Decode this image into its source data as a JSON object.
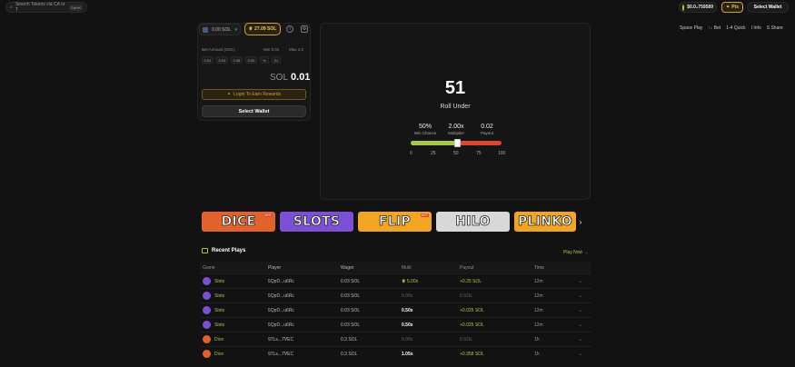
{
  "search": {
    "placeholder": "Search Tokens via CA or T",
    "kbd": "Ctrl+K"
  },
  "header": {
    "balance": "$0.0₄759589",
    "points": "Pts",
    "wallet_button": "Select Wallet"
  },
  "bet_panel": {
    "wallet_balance": "0.00 SOL",
    "rewards_balance": "27.09 SOL",
    "bet_amount_label": "Bet Amount (SOL)",
    "min_label": "Min 0.01",
    "max_label": "Max 1.0",
    "quick_amounts": [
      "0.01",
      "0.03",
      "0.08",
      "0.20",
      "½",
      "2×"
    ],
    "currency": "SOL",
    "amount": "0.01",
    "login_button": "Login To Earn Rewards",
    "select_wallet_button": "Select Wallet"
  },
  "game": {
    "roll_number": "51",
    "roll_label": "Roll Under",
    "stats": [
      {
        "value": "50%",
        "label": "Win Chance"
      },
      {
        "value": "2.00x",
        "label": "Multiplier"
      },
      {
        "value": "0.02",
        "label": "Payout"
      }
    ],
    "slider_value": 51,
    "ticks": [
      "0",
      "25",
      "50",
      "75",
      "100"
    ]
  },
  "hotkeys": [
    "Space Play",
    "↑↓ Bet",
    "1-4 Quick",
    "I Info",
    "S Share"
  ],
  "tiles": [
    {
      "label": "DICE",
      "color": "#e2622c",
      "hot": "HOT"
    },
    {
      "label": "SLOTS",
      "color": "#7c4fd6",
      "hot": ""
    },
    {
      "label": "FLIP",
      "color": "#f2a522",
      "hot": "HOT"
    },
    {
      "label": "HILO",
      "color": "#d8d8d8",
      "hot": ""
    },
    {
      "label": "PLINKO",
      "color": "#f2a522",
      "hot": ""
    }
  ],
  "recent": {
    "title": "Recent Plays",
    "play_now": "Play Now →",
    "columns": [
      "Game",
      "Player",
      "Wager",
      "Multi",
      "Payout",
      "Time"
    ],
    "rows": [
      {
        "game": "Slots",
        "player": "5QpD...u6Rc",
        "wager": "0.03 SOL",
        "multi": "5.00x",
        "payout": "+0.25 SOL",
        "time": "12m",
        "win": true
      },
      {
        "game": "Slots",
        "player": "5QpD...u6Rc",
        "wager": "0.03 SOL",
        "multi": "0.00x",
        "payout": "0 SOL",
        "time": "12m",
        "win": false
      },
      {
        "game": "Slots",
        "player": "5QpD...u6Rc",
        "wager": "0.03 SOL",
        "multi": "0.50x",
        "payout": "+0.025 SOL",
        "time": "12m",
        "win": true
      },
      {
        "game": "Slots",
        "player": "5QpD...u6Rc",
        "wager": "0.03 SOL",
        "multi": "0.50x",
        "payout": "+0.025 SOL",
        "time": "12m",
        "win": true
      },
      {
        "game": "Dice",
        "player": "97Ls...7VEC",
        "wager": "0.3 SOL",
        "multi": "0.00x",
        "payout": "0 SOL",
        "time": "1h",
        "win": false
      },
      {
        "game": "Dice",
        "player": "97Ls...7VEC",
        "wager": "0.3 SOL",
        "multi": "1.05x",
        "payout": "+0.358 SOL",
        "time": "1h",
        "win": true
      }
    ]
  },
  "colors": {
    "accent_green": "#a7c94a",
    "accent_gold": "#f0c64a",
    "loss_red": "#e0452e"
  }
}
